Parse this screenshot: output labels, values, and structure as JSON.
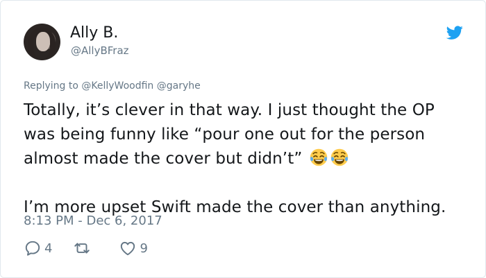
{
  "tweet": {
    "display_name": "Ally B.",
    "handle": "@AllyBFraz",
    "replying_prefix": "Replying to",
    "replying_to": [
      "@KellyWoodfin",
      "@garyhe"
    ],
    "text_lines": [
      "Totally, it’s clever in that way. I just thought the OP",
      "was being funny like “pour one out for the person",
      "almost made the cover but didn’t”"
    ],
    "text_line_4": "I’m more upset Swift made the cover than anything.",
    "emoji": [
      "face-with-tears-of-joy",
      "face-with-tears-of-joy"
    ],
    "timestamp": "8:13 PM - Dec 6, 2017",
    "actions": {
      "reply_count": "4",
      "retweet_count": "",
      "like_count": "9"
    }
  },
  "icons": {
    "brand": "twitter-bird-icon",
    "reply": "reply-icon",
    "retweet": "retweet-icon",
    "like": "heart-icon"
  },
  "colors": {
    "brand_blue": "#1da1f2",
    "muted": "#657786",
    "text": "#14171a",
    "border": "#e1e8ed"
  }
}
